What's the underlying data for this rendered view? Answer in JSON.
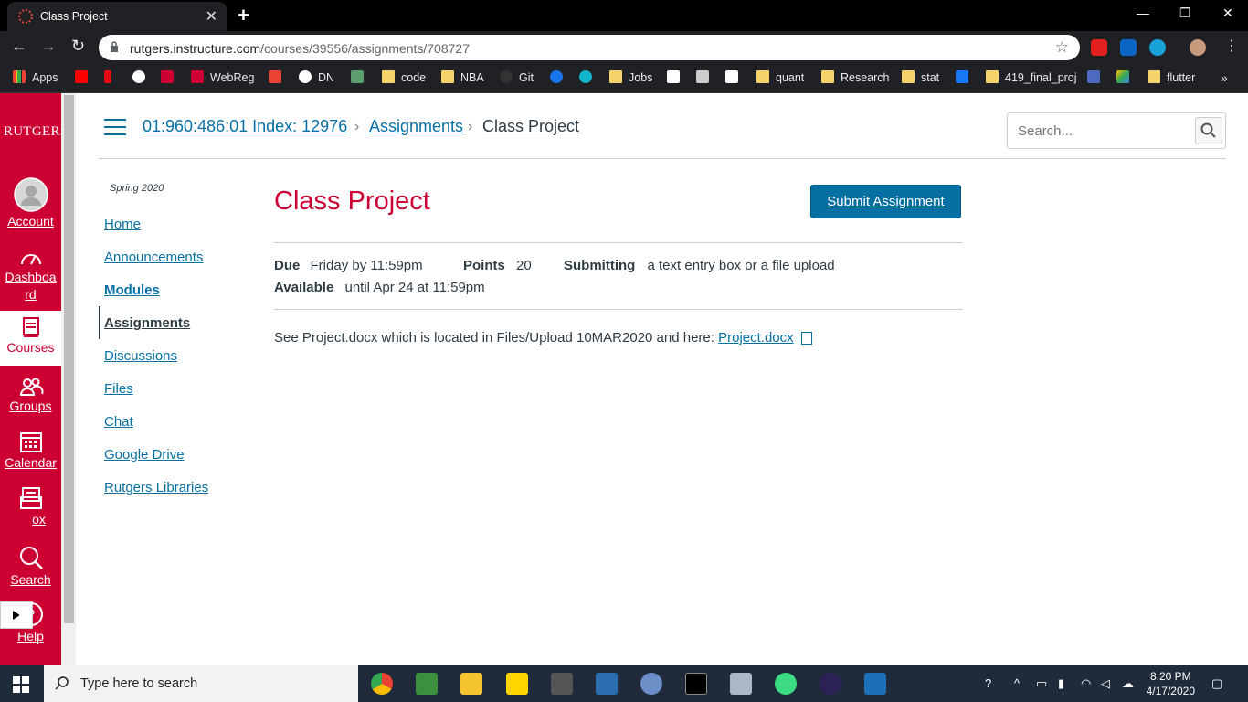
{
  "browser": {
    "tab_title": "Class Project",
    "url_host": "rutgers.instructure.com",
    "url_path": "/courses/39556/assignments/708727",
    "bookmarks": [
      "Apps",
      "WebReg",
      "DN",
      "code",
      "NBA",
      "Git",
      "Jobs",
      "quant",
      "Research",
      "stat",
      "419_final_proj",
      "flutter"
    ]
  },
  "global_nav": {
    "logo": "RUTGERS",
    "items": [
      "Account",
      "Dashboard",
      "Courses",
      "Groups",
      "Calendar",
      "Inbox",
      "Search",
      "Help"
    ],
    "dashboard_lines": [
      "Dashboa",
      "rd"
    ],
    "inbox_visible": "ox"
  },
  "header": {
    "breadcrumbs": [
      "01:960:486:01 Index: 12976",
      "Assignments",
      "Class Project"
    ],
    "search_placeholder": "Search..."
  },
  "course_nav": {
    "term": "Spring 2020",
    "items": [
      "Home",
      "Announcements",
      "Modules",
      "Assignments",
      "Discussions",
      "Files",
      "Chat",
      "Google Drive",
      "Rutgers Libraries"
    ]
  },
  "assignment": {
    "title": "Class Project",
    "submit_label": "Submit Assignment",
    "due_label": "Due",
    "due_value": "Friday by 11:59pm",
    "points_label": "Points",
    "points_value": "20",
    "submitting_label": "Submitting",
    "submitting_value": "a text entry box or a file upload",
    "available_label": "Available",
    "available_value": "until Apr 24 at 11:59pm",
    "description_text": "See Project.docx which is located in Files/Upload 10MAR2020 and here: ",
    "description_link": "Project.docx"
  },
  "taskbar": {
    "search_placeholder": "Type here to search",
    "time": "8:20 PM",
    "date": "4/17/2020"
  },
  "colors": {
    "rutgers_red": "#cc0033",
    "link_blue": "#0770a3",
    "text_dark": "#2d3b45"
  }
}
